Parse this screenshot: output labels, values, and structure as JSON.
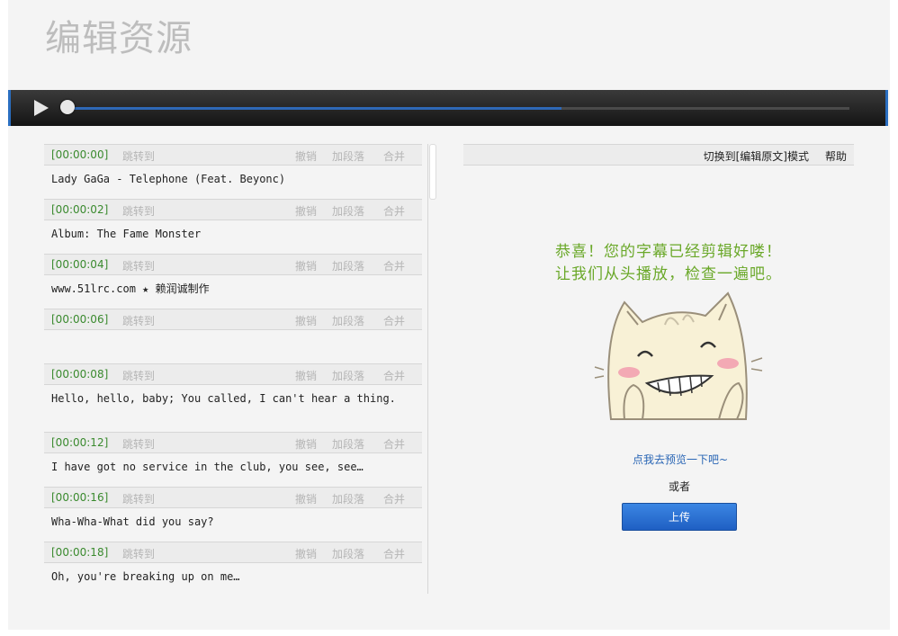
{
  "page": {
    "title": "编辑资源"
  },
  "player": {
    "progress": 0.63
  },
  "segments": [
    {
      "time": "[00:00:00]",
      "jump": "跳转到",
      "undo": "撤销",
      "add": "加段落",
      "merge": "合并",
      "text": "Lady GaGa - Telephone (Feat. Beyonc)"
    },
    {
      "time": "[00:00:02]",
      "jump": "跳转到",
      "undo": "撤销",
      "add": "加段落",
      "merge": "合并",
      "text": "Album: The Fame Monster"
    },
    {
      "time": "[00:00:04]",
      "jump": "跳转到",
      "undo": "撤销",
      "add": "加段落",
      "merge": "合并",
      "text": "www.51lrc.com ★ 赖润诚制作"
    },
    {
      "time": "[00:00:06]",
      "jump": "跳转到",
      "undo": "撤销",
      "add": "加段落",
      "merge": "合并",
      "text": ""
    },
    {
      "time": "[00:00:08]",
      "jump": "跳转到",
      "undo": "撤销",
      "add": "加段落",
      "merge": "合并",
      "text": "Hello, hello, baby; You called, I can't hear a thing."
    },
    {
      "time": "[00:00:12]",
      "jump": "跳转到",
      "undo": "撤销",
      "add": "加段落",
      "merge": "合并",
      "text": "I have got no service in the club, you see, see…"
    },
    {
      "time": "[00:00:16]",
      "jump": "跳转到",
      "undo": "撤销",
      "add": "加段落",
      "merge": "合并",
      "text": "Wha-Wha-What did you say?"
    },
    {
      "time": "[00:00:18]",
      "jump": "跳转到",
      "undo": "撤销",
      "add": "加段落",
      "merge": "合并",
      "text": "Oh, you're breaking up on me…"
    }
  ],
  "side": {
    "switch_mode": "切换到[编辑原文]模式",
    "help": "帮助",
    "congrats_line1": "恭喜！您的字幕已经剪辑好喽！",
    "congrats_line2": "让我们从头播放，检查一遍吧。",
    "preview_link": "点我去预览一下吧~",
    "or": "或者",
    "upload": "上传"
  },
  "colors": {
    "accent": "#2a6ec0",
    "timestamp": "#3a8a2e",
    "congrats": "#6aa829",
    "upload_button": "#2f74d6"
  }
}
